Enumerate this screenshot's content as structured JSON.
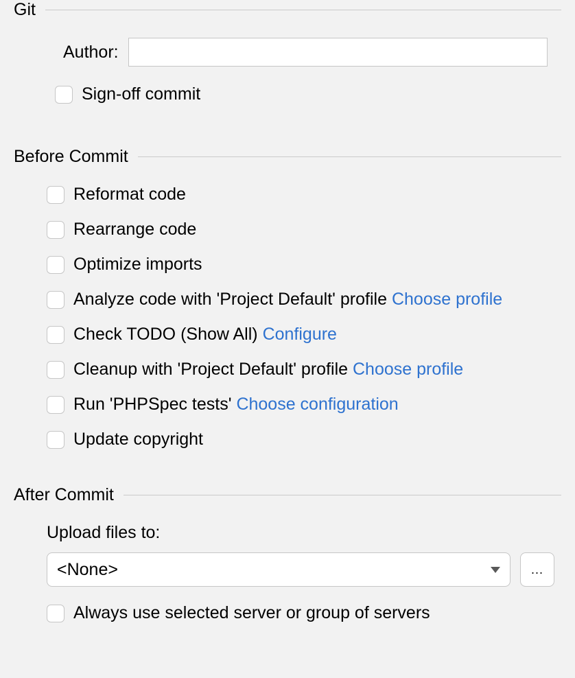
{
  "git": {
    "title": "Git",
    "author_label": "Author:",
    "author_value": "",
    "signoff_label": "Sign-off commit"
  },
  "before": {
    "title": "Before Commit",
    "items": {
      "reformat": {
        "label": "Reformat code"
      },
      "rearrange": {
        "label": "Rearrange code"
      },
      "optimize": {
        "label": "Optimize imports"
      },
      "analyze": {
        "label": "Analyze code with 'Project Default' profile ",
        "link": "Choose profile"
      },
      "todo": {
        "label": "Check TODO (Show All) ",
        "link": "Configure"
      },
      "cleanup": {
        "label": "Cleanup with 'Project Default' profile ",
        "link": "Choose profile"
      },
      "run": {
        "label": "Run 'PHPSpec tests' ",
        "link": "Choose configuration"
      },
      "copyright": {
        "label": "Update copyright"
      }
    }
  },
  "after": {
    "title": "After Commit",
    "upload_label": "Upload files to:",
    "upload_value": "<None>",
    "browse_label": "...",
    "always_label": "Always use selected server or group of servers"
  }
}
